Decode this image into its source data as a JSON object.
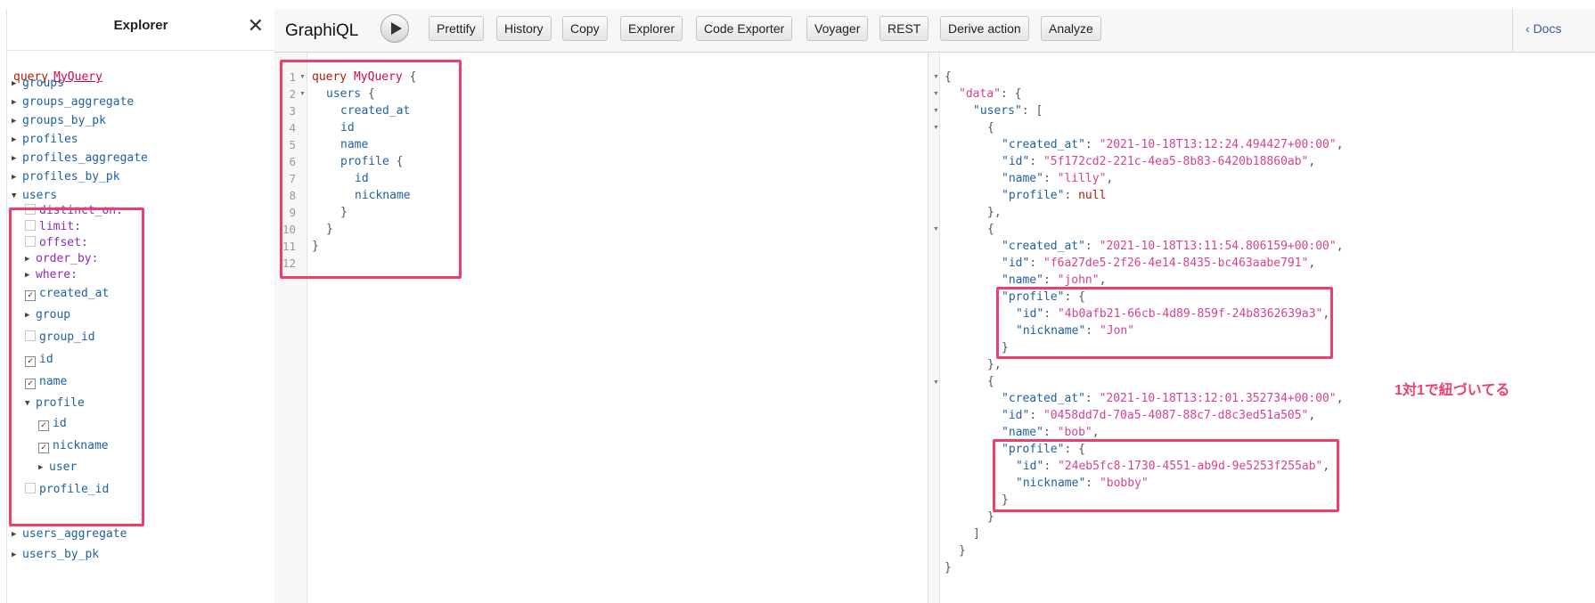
{
  "explorer": {
    "title": "Explorer",
    "close_icon": "close-icon",
    "operation_keyword": "query",
    "operation_name": "MyQuery",
    "fields": {
      "groups": "groups",
      "groups_aggregate": "groups_aggregate",
      "groups_by_pk": "groups_by_pk",
      "profiles": "profiles",
      "profiles_aggregate": "profiles_aggregate",
      "profiles_by_pk": "profiles_by_pk",
      "users": "users",
      "users_aggregate": "users_aggregate",
      "users_by_pk": "users_by_pk"
    },
    "user_args": {
      "distinct_on": "distinct_on:",
      "limit": "limit:",
      "offset": "offset:",
      "order_by": "order_by:",
      "where": "where:"
    },
    "user_fields": {
      "created_at": "created_at",
      "group": "group",
      "group_id": "group_id",
      "id": "id",
      "name": "name",
      "profile": "profile",
      "profile_id": "profile_id"
    },
    "profile_fields": {
      "id": "id",
      "nickname": "nickname",
      "user": "user"
    },
    "checked_mark": "✓"
  },
  "toolbar": {
    "title": "GraphiQL",
    "run_icon": "play-icon",
    "buttons": {
      "prettify": "Prettify",
      "history": "History",
      "copy": "Copy",
      "explorer": "Explorer",
      "code_exporter": "Code Exporter",
      "voyager": "Voyager",
      "rest": "REST",
      "derive_action": "Derive action",
      "analyze": "Analyze"
    },
    "docs": "Docs",
    "docs_icon": "chevron-left-icon"
  },
  "query_editor": {
    "line_numbers": [
      "1",
      "2",
      "3",
      "4",
      "5",
      "6",
      "7",
      "8",
      "9",
      "10",
      "11",
      "12"
    ],
    "lines": {
      "l1_kw": "query",
      "l1_name": "MyQuery",
      "l1_brace": " {",
      "l2": "users",
      "l2_brace": " {",
      "l3": "created_at",
      "l4": "id",
      "l5": "name",
      "l6": "profile",
      "l6_brace": " {",
      "l7": "id",
      "l8": "nickname",
      "l9": "}",
      "l10": "}",
      "l11": "}"
    }
  },
  "result": {
    "k_data": "\"data\"",
    "k_users": "\"users\"",
    "k_created_at": "\"created_at\"",
    "k_id": "\"id\"",
    "k_name": "\"name\"",
    "k_profile": "\"profile\"",
    "k_nickname": "\"nickname\"",
    "null_value": "null",
    "users": [
      {
        "created_at": "\"2021-10-18T13:12:24.494427+00:00\"",
        "id": "\"5f172cd2-221c-4ea5-8b83-6420b18860ab\"",
        "name": "\"lilly\""
      },
      {
        "created_at": "\"2021-10-18T13:11:54.806159+00:00\"",
        "id": "\"f6a27de5-2f26-4e14-8435-bc463aabe791\"",
        "name": "\"john\"",
        "profile_id": "\"4b0afb21-66cb-4d89-859f-24b8362639a3\"",
        "nickname": "\"Jon\""
      },
      {
        "created_at": "\"2021-10-18T13:12:01.352734+00:00\"",
        "id": "\"0458dd7d-70a5-4087-88c7-d8c3ed51a505\"",
        "name": "\"bob\"",
        "profile_id": "\"24eb5fc8-1730-4551-ab9d-9e5253f255ab\"",
        "nickname": "\"bobby\""
      }
    ]
  },
  "annotation": "1対1で紐づいてる",
  "colors": {
    "highlight": "#EE3E6C",
    "keyword": "#B11A04",
    "field": "#1F61A0",
    "string": "#D64292"
  }
}
